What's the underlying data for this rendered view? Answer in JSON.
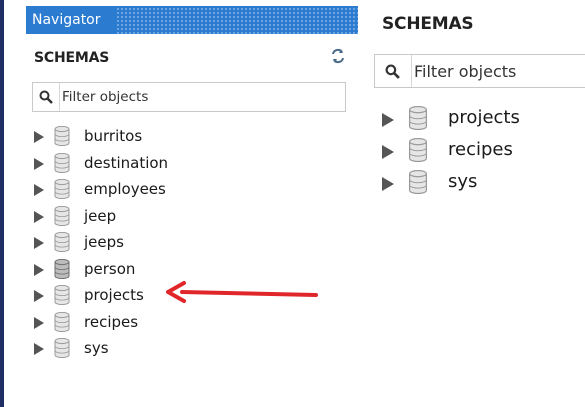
{
  "navigator": {
    "title": "Navigator",
    "schemas_title": "SCHEMAS",
    "filter_placeholder": "Filter objects",
    "items": [
      {
        "label": "burritos"
      },
      {
        "label": "destination"
      },
      {
        "label": "employees"
      },
      {
        "label": "jeep"
      },
      {
        "label": "jeeps"
      },
      {
        "label": "person"
      },
      {
        "label": "projects"
      },
      {
        "label": "recipes"
      },
      {
        "label": "sys"
      }
    ]
  },
  "filtered_panel": {
    "schemas_title": "SCHEMAS",
    "filter_placeholder": "Filter objects",
    "items": [
      {
        "label": "projects"
      },
      {
        "label": "recipes"
      },
      {
        "label": "sys"
      }
    ]
  },
  "icons": {
    "expand": "triangle-right-icon",
    "database": "database-icon",
    "search": "search-icon",
    "refresh": "refresh-icon",
    "annotation": "red-arrow-icon"
  },
  "colors": {
    "header": "#2b7bd1",
    "arrow": "#e0262b",
    "sidebar_edge": "#1f2f63"
  }
}
